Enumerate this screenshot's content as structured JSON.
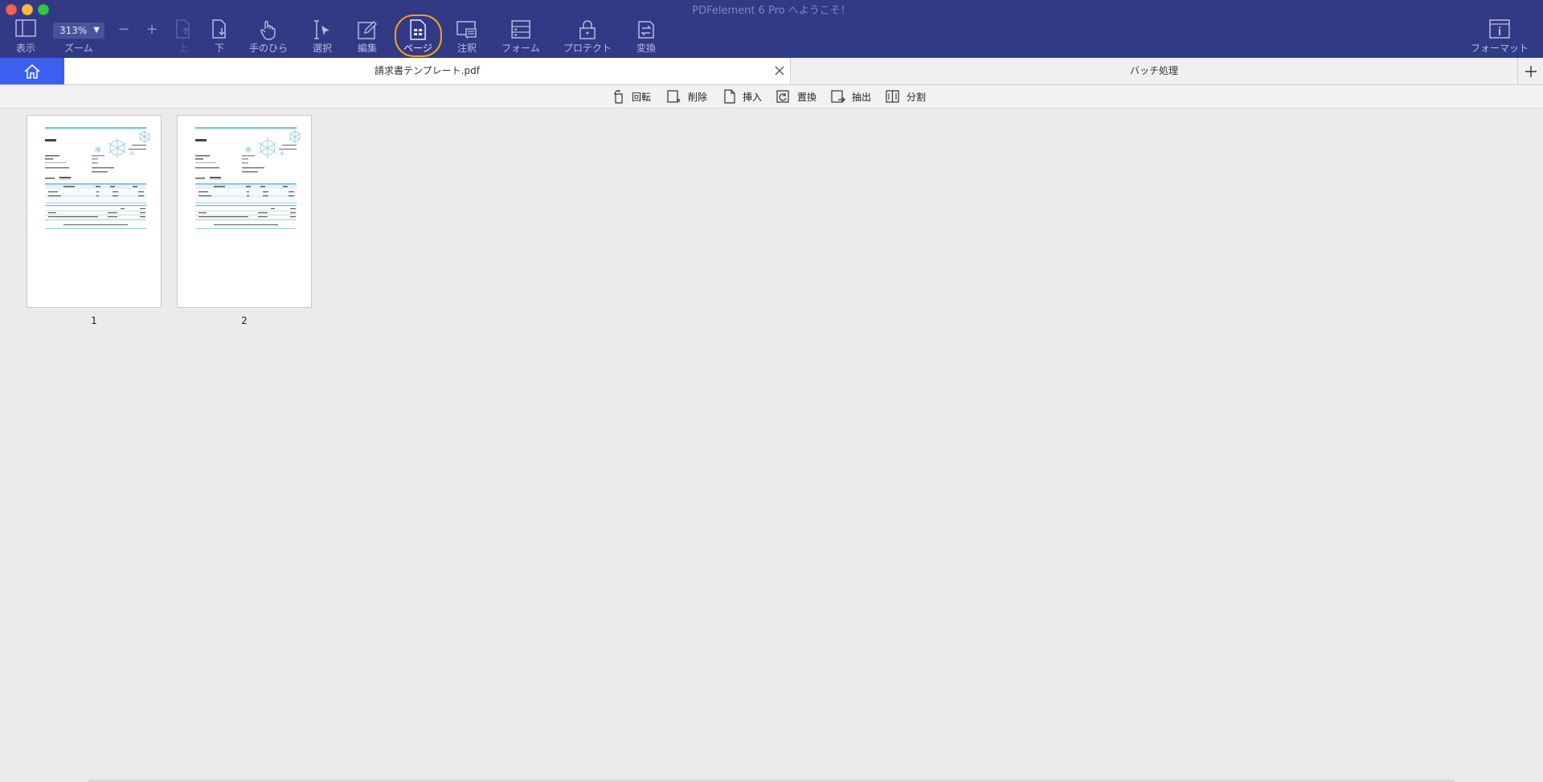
{
  "window": {
    "title": "PDFelement 6 Pro へようこそ！"
  },
  "toolbar": {
    "view_label": "表示",
    "zoom": {
      "value": "313%",
      "label": "ズーム",
      "minus": "−",
      "plus": "+"
    },
    "up_label": "上",
    "down_label": "下",
    "hand_label": "手のひら",
    "select_label": "選択",
    "edit_label": "編集",
    "page_label": "ページ",
    "comment_label": "注釈",
    "form_label": "フォーム",
    "protect_label": "プロテクト",
    "convert_label": "変換",
    "format_label": "フォーマット"
  },
  "tabs": {
    "doc": "請求書テンプレート.pdf",
    "batch": "バッチ処理"
  },
  "page_tools": {
    "rotate": "回転",
    "delete": "削除",
    "insert": "挿入",
    "replace": "置換",
    "extract": "抽出",
    "split": "分割"
  },
  "pages": [
    {
      "number": "1"
    },
    {
      "number": "2"
    }
  ],
  "colors": {
    "toolbar_bg": "#323a86",
    "home_tab": "#3a5ff2",
    "highlight": "#f3a316",
    "thumb_accent": "#7fc3dc"
  }
}
